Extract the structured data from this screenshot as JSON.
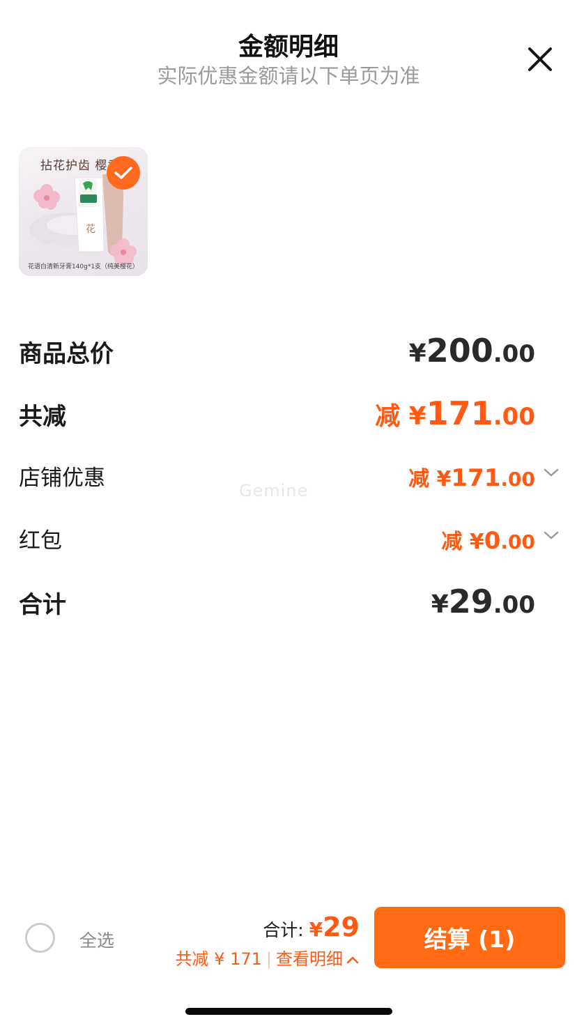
{
  "header": {
    "title": "金额明细",
    "subtitle": "实际优惠金额请以下单页为准"
  },
  "product": {
    "tagline": "拈花护齿 樱香四",
    "caption": "花语白清新牙膏140g*1支（纯美樱花）",
    "selected": true
  },
  "rows": {
    "goods_total": {
      "label": "商品总价",
      "yen": "¥",
      "int": "200",
      "dec": ".00"
    },
    "total_discount": {
      "label": "共减",
      "prefix": "减 ",
      "yen": "¥",
      "int": "171",
      "dec": ".00"
    },
    "store_discount": {
      "label": "店铺优惠",
      "prefix": "减 ",
      "yen": "¥",
      "int": "171",
      "dec": ".00"
    },
    "red_packet": {
      "label": "红包",
      "prefix": "减 ",
      "yen": "¥",
      "int": "0",
      "dec": ".00"
    },
    "sum": {
      "label": "合计",
      "yen": "¥",
      "int": "29",
      "dec": ".00"
    }
  },
  "watermark": "Gemine",
  "bottom_bar": {
    "select_all_label": "全选",
    "total_label": "合计:",
    "total_yen": "¥",
    "total_value": "29",
    "discount_text": "共减 ¥ 171",
    "view_detail": "查看明细",
    "checkout_label": "结算 (1)"
  },
  "colors": {
    "accent": "#ff6a12",
    "discount_text": "#ff5a14",
    "muted": "#9a9a9a"
  },
  "icons": [
    "close-icon",
    "check-icon",
    "chevron-down-icon",
    "chevron-up-icon",
    "radio-unchecked-icon"
  ]
}
